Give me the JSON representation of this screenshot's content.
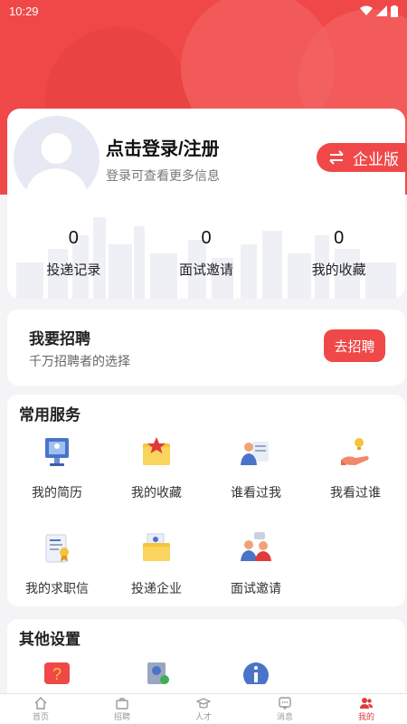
{
  "status_bar": {
    "time": "10:29"
  },
  "profile": {
    "login_title": "点击登录/注册",
    "login_subtitle": "登录可查看更多信息",
    "enterprise_label": "企业版"
  },
  "stats": [
    {
      "value": "0",
      "label": "投递记录"
    },
    {
      "value": "0",
      "label": "面试邀请"
    },
    {
      "value": "0",
      "label": "我的收藏"
    }
  ],
  "recruit": {
    "title": "我要招聘",
    "subtitle": "千万招聘者的选择",
    "button": "去招聘"
  },
  "services": {
    "title": "常用服务",
    "items": [
      {
        "label": "我的简历",
        "icon": "resume-icon"
      },
      {
        "label": "我的收藏",
        "icon": "favorite-folder-icon"
      },
      {
        "label": "谁看过我",
        "icon": "viewer-icon"
      },
      {
        "label": "我看过谁",
        "icon": "viewed-icon"
      },
      {
        "label": "我的求职信",
        "icon": "cover-letter-icon"
      },
      {
        "label": "投递企业",
        "icon": "company-folder-icon"
      },
      {
        "label": "面试邀请",
        "icon": "interview-icon"
      }
    ]
  },
  "settings": {
    "title": "其他设置",
    "icons": [
      "help-icon",
      "account-verify-icon",
      "info-icon"
    ]
  },
  "tabbar": [
    {
      "label": "首页",
      "icon": "home-icon",
      "active": false
    },
    {
      "label": "招聘",
      "icon": "briefcase-icon",
      "active": false
    },
    {
      "label": "人才",
      "icon": "graduation-cap-icon",
      "active": false
    },
    {
      "label": "消息",
      "icon": "message-icon",
      "active": false
    },
    {
      "label": "我的",
      "icon": "user-group-icon",
      "active": true
    }
  ],
  "colors": {
    "accent": "#f04848",
    "background": "#f4f4f6"
  }
}
